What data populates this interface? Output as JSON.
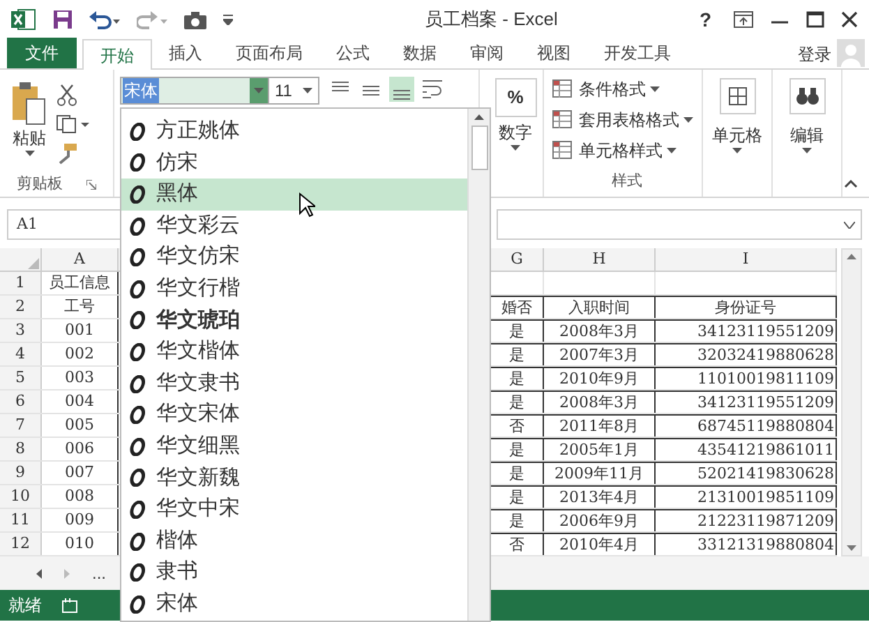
{
  "title_bar": {
    "title": "员工档案 - Excel",
    "help": "?"
  },
  "tabs": [
    {
      "label": "文件",
      "kind": "file",
      "selected": false
    },
    {
      "label": "开始",
      "kind": "tab",
      "selected": true
    },
    {
      "label": "插入",
      "kind": "tab",
      "selected": false
    },
    {
      "label": "页面布局",
      "kind": "tab",
      "selected": false
    },
    {
      "label": "公式",
      "kind": "tab",
      "selected": false
    },
    {
      "label": "数据",
      "kind": "tab",
      "selected": false
    },
    {
      "label": "审阅",
      "kind": "tab",
      "selected": false
    },
    {
      "label": "视图",
      "kind": "tab",
      "selected": false
    },
    {
      "label": "开发工具",
      "kind": "tab",
      "selected": false
    }
  ],
  "account": {
    "label": "登录"
  },
  "ribbon": {
    "paste": "粘贴",
    "clipboard_group": "剪贴板",
    "font_name": "宋体",
    "font_size": "11",
    "number_label": "数字",
    "number_symbol": "%",
    "styles": [
      "条件格式",
      "套用表格格式",
      "单元格样式"
    ],
    "styles_group": "样式",
    "cells": "单元格",
    "editing": "编辑"
  },
  "name_box": "A1",
  "columns": {
    "A": "A",
    "G": "G",
    "H": "H",
    "I": "I"
  },
  "rows": [
    {
      "num": "1",
      "A": "员工信息"
    },
    {
      "num": "2",
      "A": "工号",
      "G": "婚否",
      "H": "入职时间",
      "I": "身份证号"
    },
    {
      "num": "3",
      "A": "001",
      "G": "是",
      "H": "2008年3月",
      "I": "34123119551209"
    },
    {
      "num": "4",
      "A": "002",
      "G": "是",
      "H": "2007年3月",
      "I": "32032419880628"
    },
    {
      "num": "5",
      "A": "003",
      "G": "是",
      "H": "2010年9月",
      "I": "11010019811109"
    },
    {
      "num": "6",
      "A": "004",
      "G": "是",
      "H": "2008年3月",
      "I": "34123119551209"
    },
    {
      "num": "7",
      "A": "005",
      "G": "否",
      "H": "2011年8月",
      "I": "68745119880804"
    },
    {
      "num": "8",
      "A": "006",
      "G": "是",
      "H": "2005年1月",
      "I": "43541219861011"
    },
    {
      "num": "9",
      "A": "007",
      "G": "是",
      "H": "2009年11月",
      "I": "52021419830628"
    },
    {
      "num": "10",
      "A": "008",
      "G": "是",
      "H": "2013年4月",
      "I": "21310019851109"
    },
    {
      "num": "11",
      "A": "009",
      "G": "是",
      "H": "2006年9月",
      "I": "21223119871209"
    },
    {
      "num": "12",
      "A": "010",
      "G": "否",
      "H": "2010年4月",
      "I": "33121319880804"
    }
  ],
  "sheet_tabs": {
    "more": "..."
  },
  "status_bar": {
    "text": "就绪"
  },
  "font_list": [
    {
      "label": "方正姚体",
      "selected": false
    },
    {
      "label": "仿宋",
      "selected": false
    },
    {
      "label": "黑体",
      "selected": true
    },
    {
      "label": "华文彩云",
      "selected": false
    },
    {
      "label": "华文仿宋",
      "selected": false
    },
    {
      "label": "华文行楷",
      "selected": false
    },
    {
      "label": "华文琥珀",
      "selected": false
    },
    {
      "label": "华文楷体",
      "selected": false
    },
    {
      "label": "华文隶书",
      "selected": false
    },
    {
      "label": "华文宋体",
      "selected": false
    },
    {
      "label": "华文细黑",
      "selected": false
    },
    {
      "label": "华文新魏",
      "selected": false
    },
    {
      "label": "华文中宋",
      "selected": false
    },
    {
      "label": "楷体",
      "selected": false
    },
    {
      "label": "隶书",
      "selected": false
    },
    {
      "label": "宋体",
      "selected": false
    }
  ]
}
